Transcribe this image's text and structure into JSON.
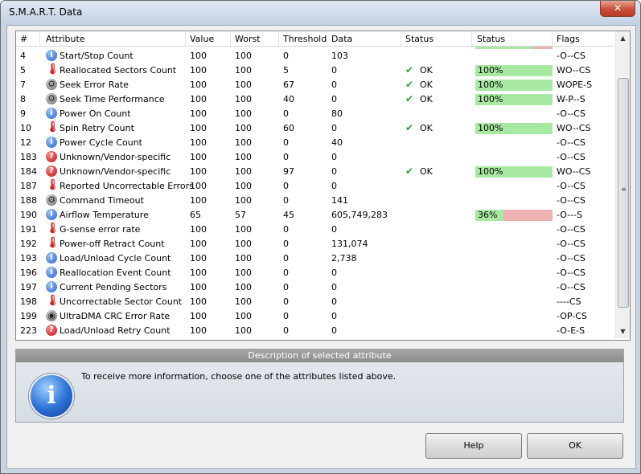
{
  "window": {
    "title": "S.M.A.R.T. Data",
    "close_label": "✕"
  },
  "table": {
    "headers": [
      "#",
      "Attribute",
      "Value",
      "Worst",
      "Threshold",
      "Data",
      "Status",
      "Status",
      "Flags"
    ],
    "top_partial_flags": "-O--CS",
    "rows": [
      {
        "id": "4",
        "attr": "Start/Stop Count",
        "icon": "info",
        "value": "100",
        "worst": "100",
        "threshold": "0",
        "data": "103",
        "status": "",
        "pct": "",
        "flags": "-O--CS"
      },
      {
        "id": "5",
        "attr": "Reallocated Sectors Count",
        "icon": "thermometer",
        "value": "100",
        "worst": "100",
        "threshold": "5",
        "data": "0",
        "status": "OK",
        "pct": "100%",
        "flags": "WO--CS"
      },
      {
        "id": "7",
        "attr": "Seek Error Rate",
        "icon": "gears",
        "value": "100",
        "worst": "100",
        "threshold": "67",
        "data": "0",
        "status": "OK",
        "pct": "100%",
        "flags": "WOPE-S"
      },
      {
        "id": "8",
        "attr": "Seek Time Performance",
        "icon": "gears",
        "value": "100",
        "worst": "100",
        "threshold": "40",
        "data": "0",
        "status": "OK",
        "pct": "100%",
        "flags": "W-P--S"
      },
      {
        "id": "9",
        "attr": "Power On Count",
        "icon": "info",
        "value": "100",
        "worst": "100",
        "threshold": "0",
        "data": "80",
        "status": "",
        "pct": "",
        "flags": "-O--CS"
      },
      {
        "id": "10",
        "attr": "Spin Retry Count",
        "icon": "thermometer",
        "value": "100",
        "worst": "100",
        "threshold": "60",
        "data": "0",
        "status": "OK",
        "pct": "100%",
        "flags": "WO--CS"
      },
      {
        "id": "12",
        "attr": "Power Cycle Count",
        "icon": "info",
        "value": "100",
        "worst": "100",
        "threshold": "0",
        "data": "40",
        "status": "",
        "pct": "",
        "flags": "-O--CS"
      },
      {
        "id": "183",
        "attr": "Unknown/Vendor-specific",
        "icon": "warning",
        "value": "100",
        "worst": "100",
        "threshold": "0",
        "data": "0",
        "status": "",
        "pct": "",
        "flags": "-O--CS"
      },
      {
        "id": "184",
        "attr": "Unknown/Vendor-specific",
        "icon": "warning",
        "value": "100",
        "worst": "100",
        "threshold": "97",
        "data": "0",
        "status": "OK",
        "pct": "100%",
        "flags": "WO--CS"
      },
      {
        "id": "187",
        "attr": "Reported Uncorrectable Errors",
        "icon": "thermometer",
        "value": "100",
        "worst": "100",
        "threshold": "0",
        "data": "0",
        "status": "",
        "pct": "",
        "flags": "-O--CS"
      },
      {
        "id": "188",
        "attr": "Command Timeout",
        "icon": "gears",
        "value": "100",
        "worst": "100",
        "threshold": "0",
        "data": "141",
        "status": "",
        "pct": "",
        "flags": "-O--CS"
      },
      {
        "id": "190",
        "attr": "Airflow Temperature",
        "icon": "info",
        "value": "65",
        "worst": "57",
        "threshold": "45",
        "data": "605,749,283",
        "status": "",
        "pct": "36%",
        "flags": "-O---S"
      },
      {
        "id": "191",
        "attr": "G-sense error rate",
        "icon": "thermometer",
        "value": "100",
        "worst": "100",
        "threshold": "0",
        "data": "0",
        "status": "",
        "pct": "",
        "flags": "-O--CS"
      },
      {
        "id": "192",
        "attr": "Power-off Retract Count",
        "icon": "thermometer",
        "value": "100",
        "worst": "100",
        "threshold": "0",
        "data": "131,074",
        "status": "",
        "pct": "",
        "flags": "-O--CS"
      },
      {
        "id": "193",
        "attr": "Load/Unload Cycle Count",
        "icon": "info",
        "value": "100",
        "worst": "100",
        "threshold": "0",
        "data": "2,738",
        "status": "",
        "pct": "",
        "flags": "-O--CS"
      },
      {
        "id": "196",
        "attr": "Reallocation Event Count",
        "icon": "info",
        "value": "100",
        "worst": "100",
        "threshold": "0",
        "data": "0",
        "status": "",
        "pct": "",
        "flags": "-O--CS"
      },
      {
        "id": "197",
        "attr": "Current Pending Sectors",
        "icon": "info",
        "value": "100",
        "worst": "100",
        "threshold": "0",
        "data": "0",
        "status": "",
        "pct": "",
        "flags": "-O--CS"
      },
      {
        "id": "198",
        "attr": "Uncorrectable Sector Count",
        "icon": "thermometer",
        "value": "100",
        "worst": "100",
        "threshold": "0",
        "data": "0",
        "status": "",
        "pct": "",
        "flags": "----CS"
      },
      {
        "id": "199",
        "attr": "UltraDMA CRC Error Rate",
        "icon": "disk",
        "value": "100",
        "worst": "100",
        "threshold": "0",
        "data": "0",
        "status": "",
        "pct": "",
        "flags": "-OP-CS"
      },
      {
        "id": "223",
        "attr": "Load/Unload Retry Count",
        "icon": "warning",
        "value": "100",
        "worst": "100",
        "threshold": "0",
        "data": "0",
        "status": "",
        "pct": "",
        "flags": "-O-E-S"
      }
    ]
  },
  "description": {
    "header": "Description of selected attribute",
    "text": "To receive more information, choose one of the attributes listed above."
  },
  "buttons": {
    "help": "Help",
    "ok": "OK"
  },
  "colors": {
    "bar_green": "#a9e8a2",
    "bar_red": "#efb2b2",
    "ok_green": "#2ea02e"
  }
}
